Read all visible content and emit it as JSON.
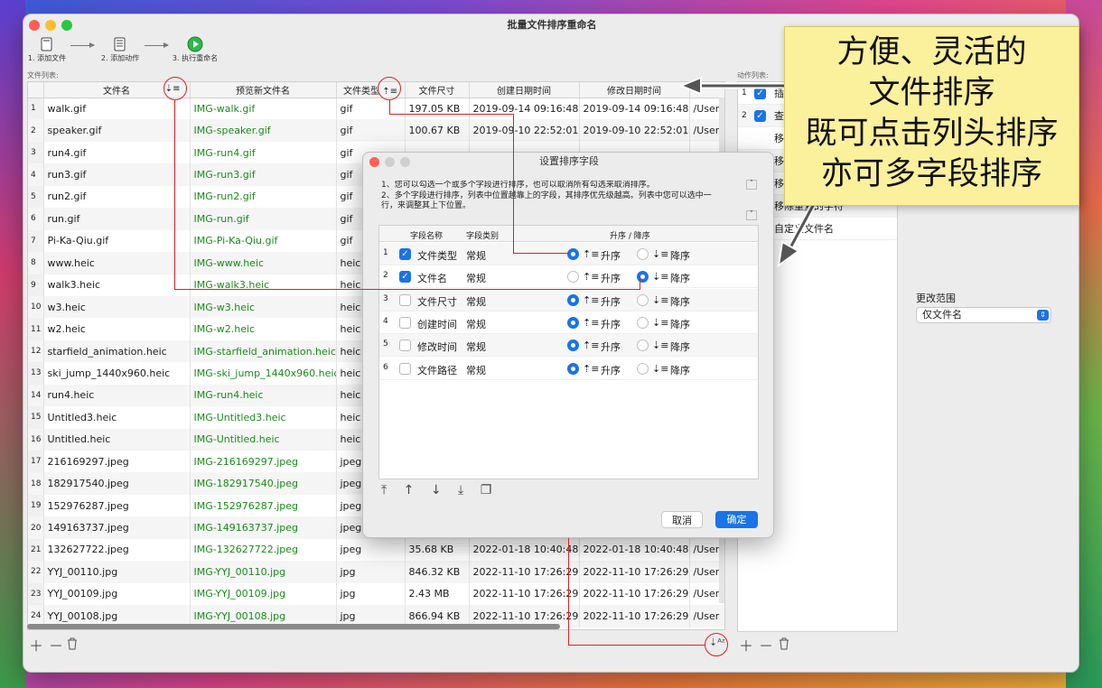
{
  "window": {
    "title": "批量文件排序重命名"
  },
  "toolbar": {
    "step1": "1. 添加文件",
    "step2": "2. 添加动作",
    "step3": "3. 执行重命名"
  },
  "left_section_label": "文件列表:",
  "right_section_label": "动作列表:",
  "columns": {
    "filename": "文件名",
    "preview": "预览新文件名",
    "type": "文件类型",
    "size": "文件尺寸",
    "created": "创建日期时间",
    "modified": "修改日期时间"
  },
  "files": [
    {
      "n": "1",
      "name": "walk.gif",
      "preview": "IMG-walk.gif",
      "type": "gif",
      "size": "197.05 KB",
      "created": "2019-09-14 09:16:48",
      "modified": "2019-09-14 09:16:48",
      "path": "/User"
    },
    {
      "n": "2",
      "name": "speaker.gif",
      "preview": "IMG-speaker.gif",
      "type": "gif",
      "size": "100.67 KB",
      "created": "2019-09-10 22:52:01",
      "modified": "2019-09-10 22:52:01",
      "path": "/User"
    },
    {
      "n": "3",
      "name": "run4.gif",
      "preview": "IMG-run4.gif",
      "type": "gif",
      "size": "",
      "created": "",
      "modified": "",
      "path": ""
    },
    {
      "n": "4",
      "name": "run3.gif",
      "preview": "IMG-run3.gif",
      "type": "gif",
      "size": "",
      "created": "",
      "modified": "",
      "path": ""
    },
    {
      "n": "5",
      "name": "run2.gif",
      "preview": "IMG-run2.gif",
      "type": "gif",
      "size": "",
      "created": "",
      "modified": "",
      "path": ""
    },
    {
      "n": "6",
      "name": "run.gif",
      "preview": "IMG-run.gif",
      "type": "gif",
      "size": "",
      "created": "",
      "modified": "",
      "path": ""
    },
    {
      "n": "7",
      "name": "Pi-Ka-Qiu.gif",
      "preview": "IMG-Pi-Ka-Qiu.gif",
      "type": "gif",
      "size": "",
      "created": "",
      "modified": "",
      "path": ""
    },
    {
      "n": "8",
      "name": "www.heic",
      "preview": "IMG-www.heic",
      "type": "heic",
      "size": "",
      "created": "",
      "modified": "",
      "path": ""
    },
    {
      "n": "9",
      "name": "walk3.heic",
      "preview": "IMG-walk3.heic",
      "type": "heic",
      "size": "",
      "created": "",
      "modified": "",
      "path": ""
    },
    {
      "n": "10",
      "name": "w3.heic",
      "preview": "IMG-w3.heic",
      "type": "heic",
      "size": "",
      "created": "",
      "modified": "",
      "path": ""
    },
    {
      "n": "11",
      "name": "w2.heic",
      "preview": "IMG-w2.heic",
      "type": "heic",
      "size": "",
      "created": "",
      "modified": "",
      "path": ""
    },
    {
      "n": "12",
      "name": "starfield_animation.heic",
      "preview": "IMG-starfield_animation.heic",
      "type": "heic",
      "size": "",
      "created": "",
      "modified": "",
      "path": ""
    },
    {
      "n": "13",
      "name": "ski_jump_1440x960.heic",
      "preview": "IMG-ski_jump_1440x960.heic",
      "type": "heic",
      "size": "",
      "created": "",
      "modified": "",
      "path": ""
    },
    {
      "n": "14",
      "name": "run4.heic",
      "preview": "IMG-run4.heic",
      "type": "heic",
      "size": "",
      "created": "",
      "modified": "",
      "path": ""
    },
    {
      "n": "15",
      "name": "Untitled3.heic",
      "preview": "IMG-Untitled3.heic",
      "type": "heic",
      "size": "",
      "created": "",
      "modified": "",
      "path": ""
    },
    {
      "n": "16",
      "name": "Untitled.heic",
      "preview": "IMG-Untitled.heic",
      "type": "heic",
      "size": "",
      "created": "",
      "modified": "",
      "path": ""
    },
    {
      "n": "17",
      "name": "216169297.jpeg",
      "preview": "IMG-216169297.jpeg",
      "type": "jpeg",
      "size": "",
      "created": "",
      "modified": "",
      "path": ""
    },
    {
      "n": "18",
      "name": "182917540.jpeg",
      "preview": "IMG-182917540.jpeg",
      "type": "jpeg",
      "size": "",
      "created": "",
      "modified": "",
      "path": ""
    },
    {
      "n": "19",
      "name": "152976287.jpeg",
      "preview": "IMG-152976287.jpeg",
      "type": "jpeg",
      "size": "",
      "created": "",
      "modified": "",
      "path": ""
    },
    {
      "n": "20",
      "name": "149163737.jpeg",
      "preview": "IMG-149163737.jpeg",
      "type": "jpeg",
      "size": "",
      "created": "",
      "modified": "",
      "path": ""
    },
    {
      "n": "21",
      "name": "132627722.jpeg",
      "preview": "IMG-132627722.jpeg",
      "type": "jpeg",
      "size": "35.68 KB",
      "created": "2022-01-18 10:40:48",
      "modified": "2022-01-18 10:40:48",
      "path": "/User"
    },
    {
      "n": "22",
      "name": "YYJ_00110.jpg",
      "preview": "IMG-YYJ_00110.jpg",
      "type": "jpg",
      "size": "846.32 KB",
      "created": "2022-11-10 17:26:29",
      "modified": "2022-11-10 17:26:29",
      "path": "/User"
    },
    {
      "n": "23",
      "name": "YYJ_00109.jpg",
      "preview": "IMG-YYJ_00109.jpg",
      "type": "jpg",
      "size": "2.43 MB",
      "created": "2022-11-10 17:26:29",
      "modified": "2022-11-10 17:26:29",
      "path": "/User"
    },
    {
      "n": "24",
      "name": "YYJ_00108.jpg",
      "preview": "IMG-YYJ_00108.jpg",
      "type": "jpg",
      "size": "866.94 KB",
      "created": "2022-11-10 17:26:29",
      "modified": "2022-11-10 17:26:29",
      "path": "/User"
    }
  ],
  "actions": [
    {
      "n": "1",
      "label": "插入"
    },
    {
      "n": "2",
      "label": "查找"
    },
    {
      "n": "",
      "label": "移动"
    },
    {
      "n": "",
      "label": "移除"
    },
    {
      "n": "",
      "label": "移除"
    },
    {
      "n": "",
      "label": "移除重复的字符"
    },
    {
      "n": "",
      "label": "自定义文件名"
    }
  ],
  "scope": {
    "label": "更改范围",
    "value": "仅文件名"
  },
  "dialog": {
    "title": "设置排序字段",
    "desc1": "1、您可以勾选一个或多个字段进行排序，也可以取消所有勾选来取消排序。",
    "desc2": "2、多个字段进行排序，列表中位置越靠上的字段，其排序优先级越高。列表中您可以选中一",
    "desc3": "行，来调整其上下位置。",
    "headers": {
      "name": "字段名称",
      "category": "字段类别",
      "order": "升序 / 降序"
    },
    "asc": "升序",
    "desc": "降序",
    "fields": [
      {
        "n": "1",
        "name": "文件类型",
        "cat": "常规",
        "checked": true,
        "order": "asc"
      },
      {
        "n": "2",
        "name": "文件名",
        "cat": "常规",
        "checked": true,
        "order": "desc"
      },
      {
        "n": "3",
        "name": "文件尺寸",
        "cat": "常规",
        "checked": false,
        "order": "asc"
      },
      {
        "n": "4",
        "name": "创建时间",
        "cat": "常规",
        "checked": false,
        "order": "asc"
      },
      {
        "n": "5",
        "name": "修改时间",
        "cat": "常规",
        "checked": false,
        "order": "asc"
      },
      {
        "n": "6",
        "name": "文件路径",
        "cat": "常规",
        "checked": false,
        "order": "asc"
      }
    ],
    "cancel": "取消",
    "ok": "确定"
  },
  "note": {
    "line1": "方便、灵活的",
    "line2": "文件排序",
    "line3": "既可点击列头排序",
    "line4": "亦可多字段排序"
  },
  "colors": {
    "accent": "#1a73e8",
    "green_text": "#1a8a1a",
    "annotation": "#e02020",
    "note_bg": "#fbf09c"
  }
}
